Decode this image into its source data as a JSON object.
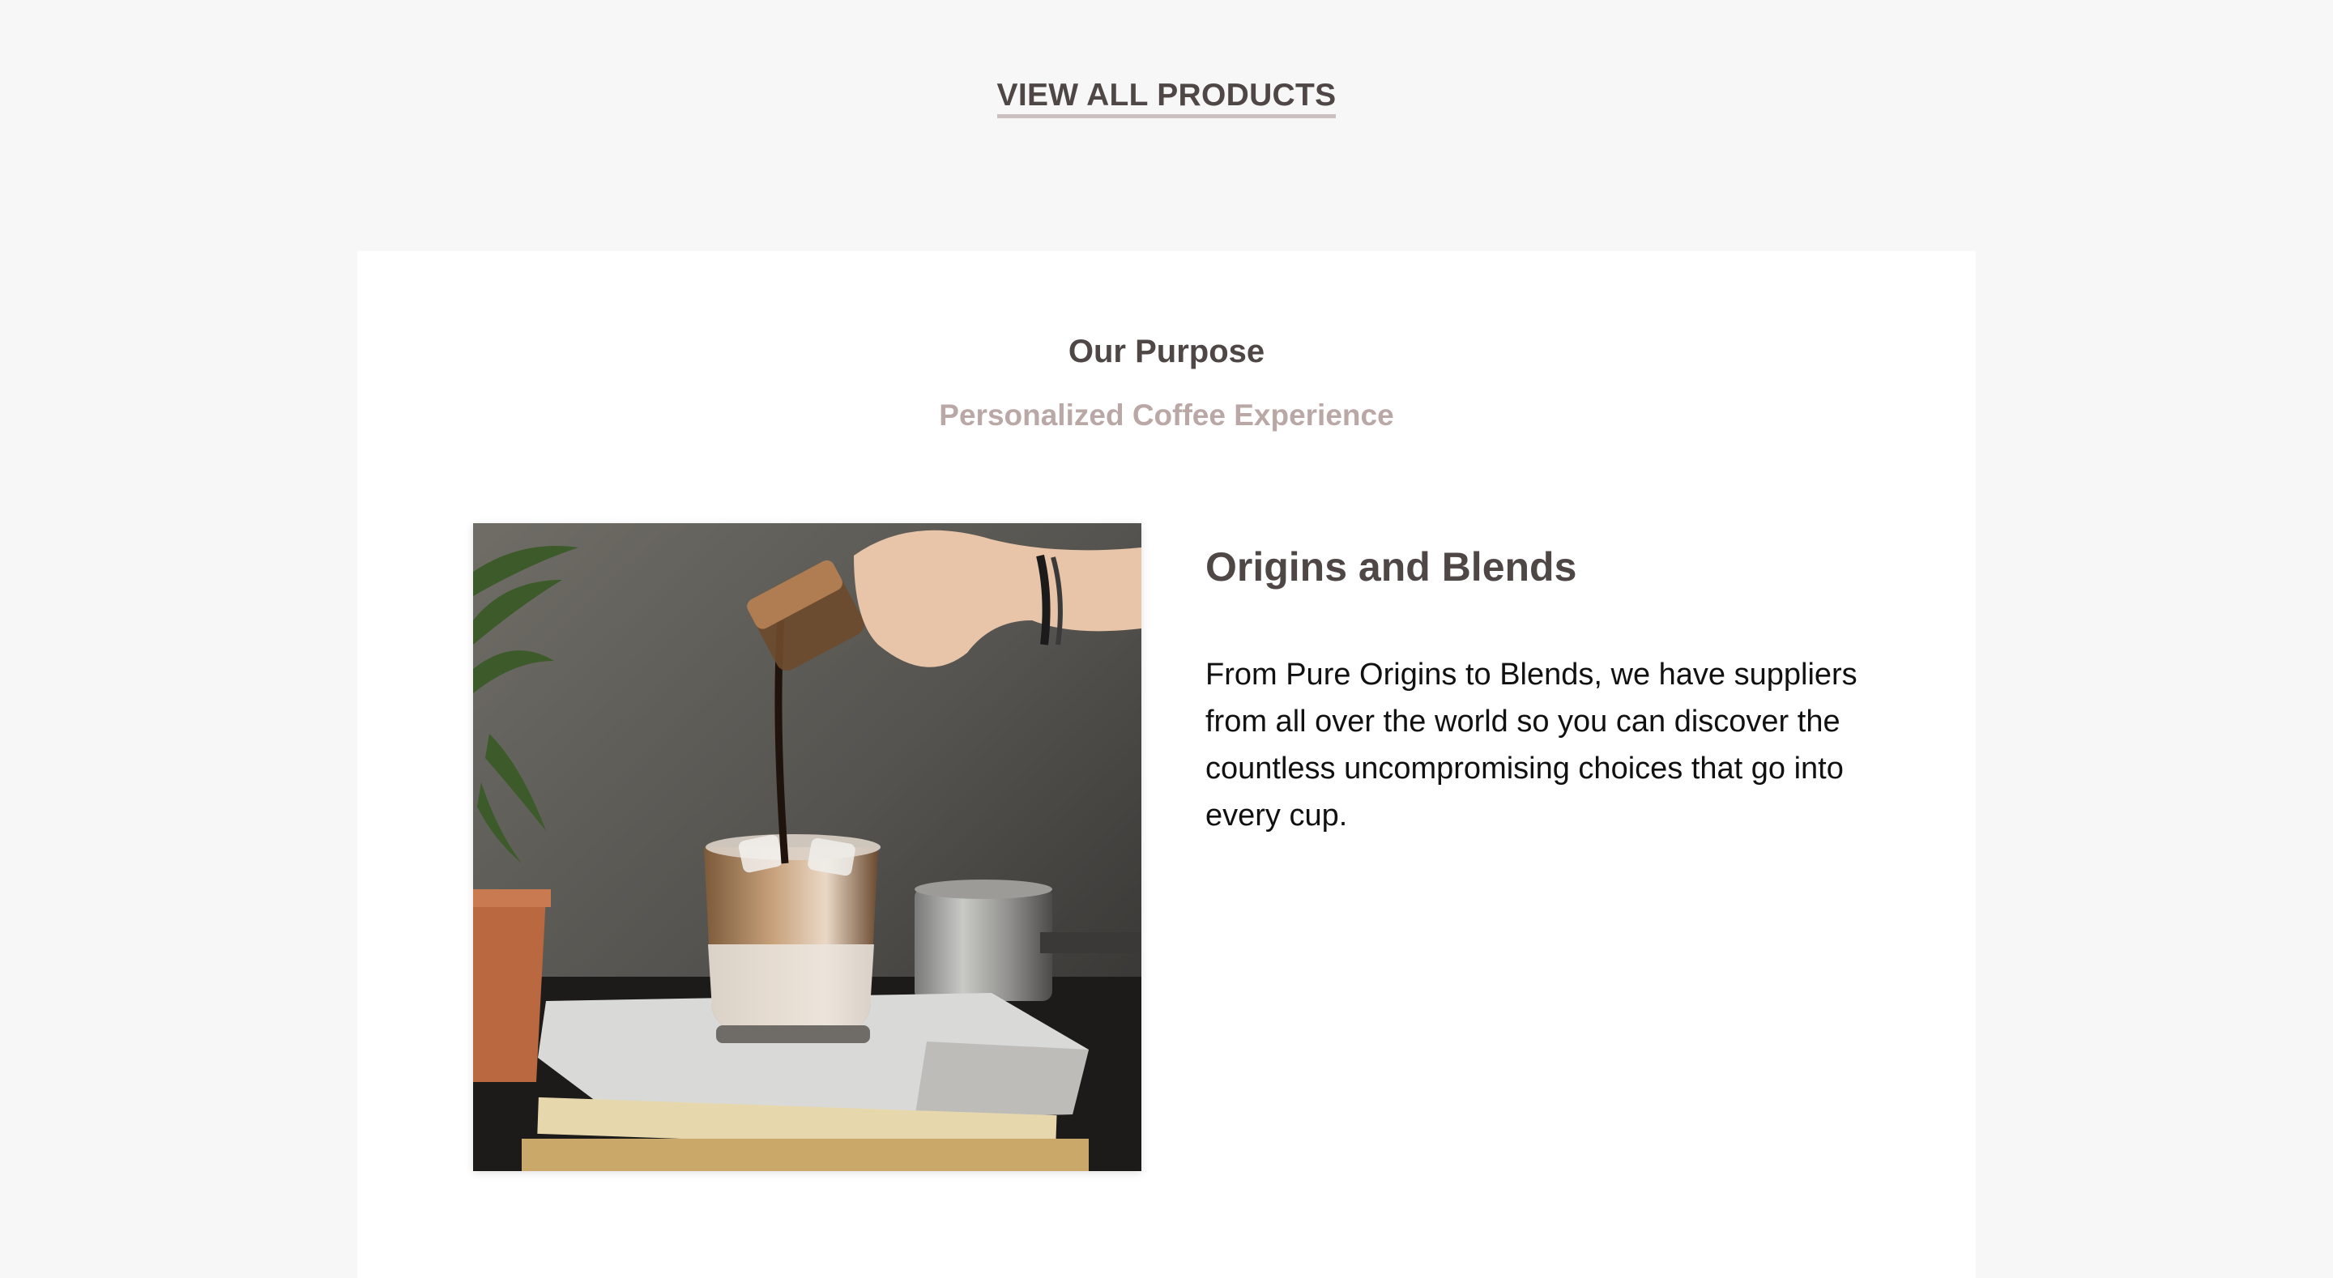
{
  "header": {
    "view_all_label": "VIEW ALL PRODUCTS"
  },
  "purpose": {
    "title": "Our Purpose",
    "subtitle": "Personalized Coffee Experience"
  },
  "feature": {
    "title": "Origins and Blends",
    "text": "From Pure Origins to Blends, we have suppliers from all over the world so you can discover the countless uncompromising choices that go into every cup.",
    "image_subject": "coffee-pour-photo"
  },
  "colors": {
    "background": "#f7f7f8",
    "card": "#ffffff",
    "heading": "#4e4746",
    "accent_muted": "#b9a8a6",
    "underline": "#c9c0bf",
    "body_text": "#111111"
  }
}
